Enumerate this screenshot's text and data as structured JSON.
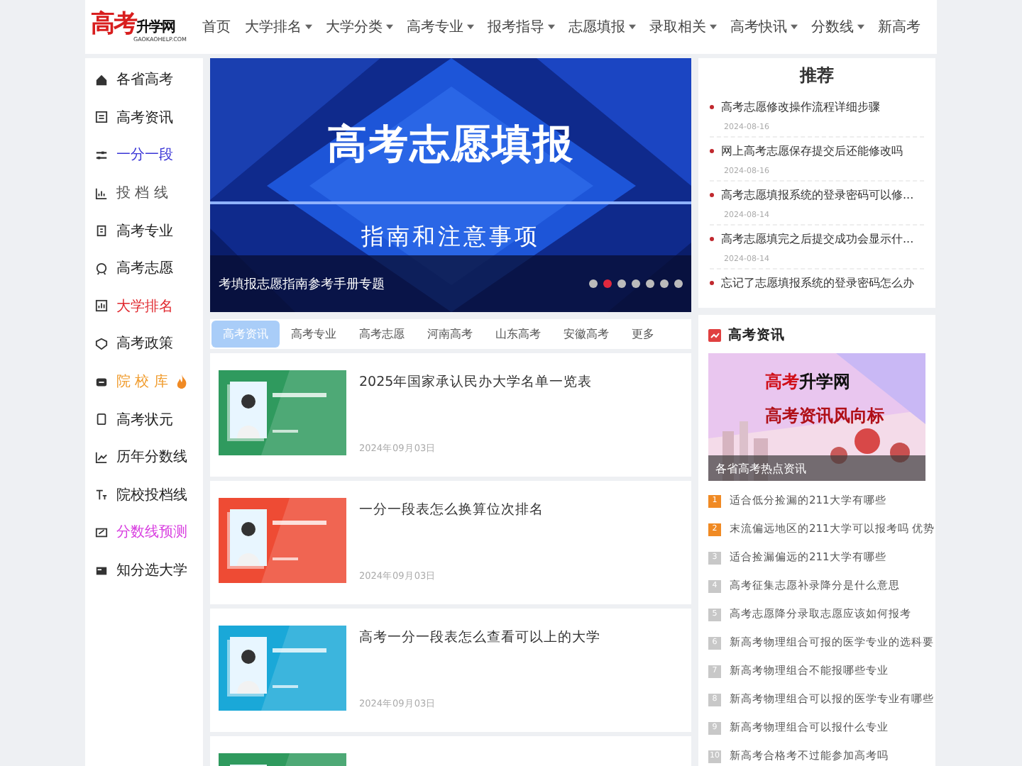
{
  "logo": {
    "main": "高考",
    "sub": "升学网",
    "domain": "GAOKAOHELP.COM"
  },
  "nav": [
    {
      "label": "首页",
      "has_menu": false
    },
    {
      "label": "大学排名",
      "has_menu": true
    },
    {
      "label": "大学分类",
      "has_menu": true
    },
    {
      "label": "高考专业",
      "has_menu": true
    },
    {
      "label": "报考指导",
      "has_menu": true
    },
    {
      "label": "志愿填报",
      "has_menu": true
    },
    {
      "label": "录取相关",
      "has_menu": true
    },
    {
      "label": "高考快讯",
      "has_menu": true
    },
    {
      "label": "分数线",
      "has_menu": true
    },
    {
      "label": "新高考",
      "has_menu": false
    }
  ],
  "sidebar": {
    "items": [
      {
        "label": "各省高考",
        "color": "#222222",
        "hot": false
      },
      {
        "label": "高考资讯",
        "color": "#222222",
        "hot": false
      },
      {
        "label": "一分一段",
        "color": "#3a35d6",
        "hot": false
      },
      {
        "label": "投 档 线",
        "color": "#555555",
        "hot": false
      },
      {
        "label": "高考专业",
        "color": "#222222",
        "hot": false
      },
      {
        "label": "高考志愿",
        "color": "#222222",
        "hot": false
      },
      {
        "label": "大学排名",
        "color": "#e0282e",
        "hot": false
      },
      {
        "label": "高考政策",
        "color": "#222222",
        "hot": false
      },
      {
        "label": "院 校 库",
        "color": "#f09a2a",
        "hot": true
      },
      {
        "label": "高考状元",
        "color": "#222222",
        "hot": false
      },
      {
        "label": "历年分数线",
        "color": "#222222",
        "hot": false
      },
      {
        "label": "院校投档线",
        "color": "#222222",
        "hot": false
      },
      {
        "label": "分数线预测",
        "color": "#d83ee0",
        "hot": false
      },
      {
        "label": "知分选大学",
        "color": "#222222",
        "hot": false
      }
    ]
  },
  "carousel": {
    "heading": "高考志愿填报",
    "subheading": "指南和注意事项",
    "caption": "考填报志愿指南参考手册专题",
    "dots": [
      {
        "selected": false
      },
      {
        "selected": true
      },
      {
        "selected": false
      },
      {
        "selected": false
      },
      {
        "selected": false
      },
      {
        "selected": false
      },
      {
        "selected": false
      }
    ]
  },
  "tabs": [
    {
      "label": "高考资讯",
      "selected": true
    },
    {
      "label": "高考专业",
      "selected": false
    },
    {
      "label": "高考志愿",
      "selected": false
    },
    {
      "label": "河南高考",
      "selected": false
    },
    {
      "label": "山东高考",
      "selected": false
    },
    {
      "label": "安徽高考",
      "selected": false
    },
    {
      "label": "更多",
      "selected": false
    }
  ],
  "articles": [
    {
      "title": "2025年国家承认民办大学名单一览表",
      "date": "2024年09月03日",
      "color": "#2f9a5e"
    },
    {
      "title": "一分一段表怎么换算位次排名",
      "date": "2024年09月03日",
      "color": "#ee4b34"
    },
    {
      "title": "高考一分一段表怎么查看可以上的大学",
      "date": "2024年09月03日",
      "color": "#1aa8d8"
    },
    {
      "color": "#2f9a5e"
    }
  ],
  "recommend": {
    "title": "推荐",
    "items": [
      {
        "title": "高考志愿修改操作流程详细步骤",
        "date": "2024-08-16"
      },
      {
        "title": "网上高考志愿保存提交后还能修改吗",
        "date": "2024-08-16"
      },
      {
        "title": "高考志愿填报系统的登录密码可以修...",
        "date": "2024-08-14"
      },
      {
        "title": "高考志愿填完之后提交成功会显示什...",
        "date": "2024-08-14"
      },
      {
        "title": "忘记了志愿填报系统的登录密码怎么办"
      }
    ]
  },
  "news": {
    "title": "高考资讯",
    "banner_brand_main": "高考",
    "banner_brand_sub": "升学网",
    "banner_slogan": "高考资讯风向标",
    "banner_caption": "各省高考热点资讯",
    "items": [
      {
        "rank": "1",
        "title": "适合低分捡漏的211大学有哪些",
        "color": "#f08a24"
      },
      {
        "rank": "2",
        "title": "末流偏远地区的211大学可以报考吗 优势",
        "color": "#f08a24"
      },
      {
        "rank": "3",
        "title": "适合捡漏偏远的211大学有哪些",
        "color": "#c8c8c8"
      },
      {
        "rank": "4",
        "title": "高考征集志愿补录降分是什么意思",
        "color": "#c8c8c8"
      },
      {
        "rank": "5",
        "title": "高考志愿降分录取志愿应该如何报考",
        "color": "#c8c8c8"
      },
      {
        "rank": "6",
        "title": "新高考物理组合可报的医学专业的选科要",
        "color": "#c8c8c8"
      },
      {
        "rank": "7",
        "title": "新高考物理组合不能报哪些专业",
        "color": "#c8c8c8"
      },
      {
        "rank": "8",
        "title": "新高考物理组合可以报的医学专业有哪些",
        "color": "#c8c8c8"
      },
      {
        "rank": "9",
        "title": "新高考物理组合可以报什么专业",
        "color": "#c8c8c8"
      },
      {
        "rank": "10",
        "title": "新高考合格考不过能参加高考吗",
        "color": "#c8c8c8"
      }
    ]
  }
}
